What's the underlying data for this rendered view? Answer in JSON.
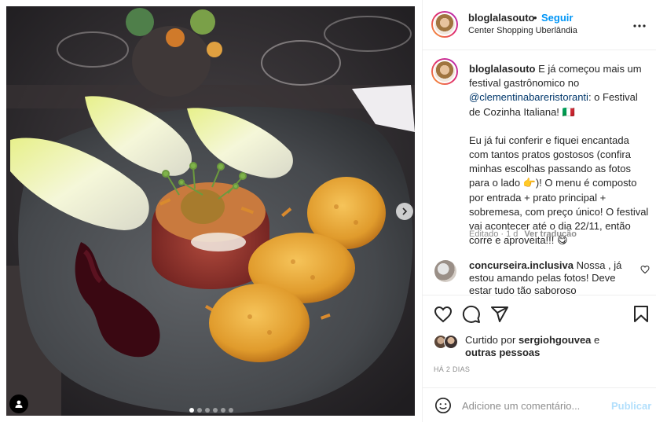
{
  "post": {
    "username": "bloglalasouto",
    "separator": "•",
    "follow_label": "Seguir",
    "location": "Center Shopping Uberlândia",
    "more_icon": "more-horizontal-icon"
  },
  "caption": {
    "username": "bloglalasouto",
    "line1_pre": "E já começou mais um festival gastrônomico no",
    "mention": "@clementinabareristoranti",
    "line1_post": ": o Festival de Cozinha Italiana! 🇮🇹",
    "paragraph2": "Eu já fui conferir e fiquei encantada com tantos pratos gostosos (confira minhas escolhas passando as fotos para o lado 👉)! O menu é composto por entrada + prato principal + sobremesa, com preço único! O festival vai acontecer até o dia 22/11, então corre e aproveita!!! 😋",
    "edited": "Editado · 1 d",
    "translate": "Ver tradução"
  },
  "reply": {
    "username": "concurseira.inclusiva",
    "text": "Nossa , já estou amando pelas fotos! Deve estar tudo tão saboroso"
  },
  "actions": {
    "like_icon": "heart-icon",
    "comment_icon": "comment-icon",
    "share_icon": "paper-plane-icon",
    "save_icon": "bookmark-icon"
  },
  "likes": {
    "prefix": "Curtido por",
    "user": "sergiohgouvea",
    "and": "e",
    "others": "outras pessoas"
  },
  "date": "HÁ 2 DIAS",
  "comment_box": {
    "placeholder": "Adicione um comentário...",
    "publish_label": "Publicar"
  },
  "carousel": {
    "total_slides": 6,
    "active_index": 0
  },
  "colors": {
    "link_blue": "#0095f6",
    "mention_blue": "#00376b",
    "publish_disabled": "#b2dffc",
    "meta_gray": "#8e8e8e"
  }
}
